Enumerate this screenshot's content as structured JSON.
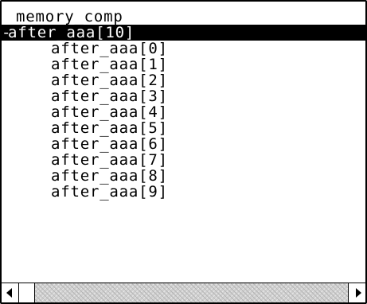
{
  "tree": {
    "root_label": "memory_comp",
    "group_marker": "-",
    "group_label": "after_aaa[10]",
    "items": [
      "after_aaa[0]",
      "after_aaa[1]",
      "after_aaa[2]",
      "after_aaa[3]",
      "after_aaa[4]",
      "after_aaa[5]",
      "after_aaa[6]",
      "after_aaa[7]",
      "after_aaa[8]",
      "after_aaa[9]"
    ]
  },
  "scrollbar": {
    "left_arrow_icon": "arrow-left-icon",
    "right_arrow_icon": "arrow-right-icon"
  }
}
